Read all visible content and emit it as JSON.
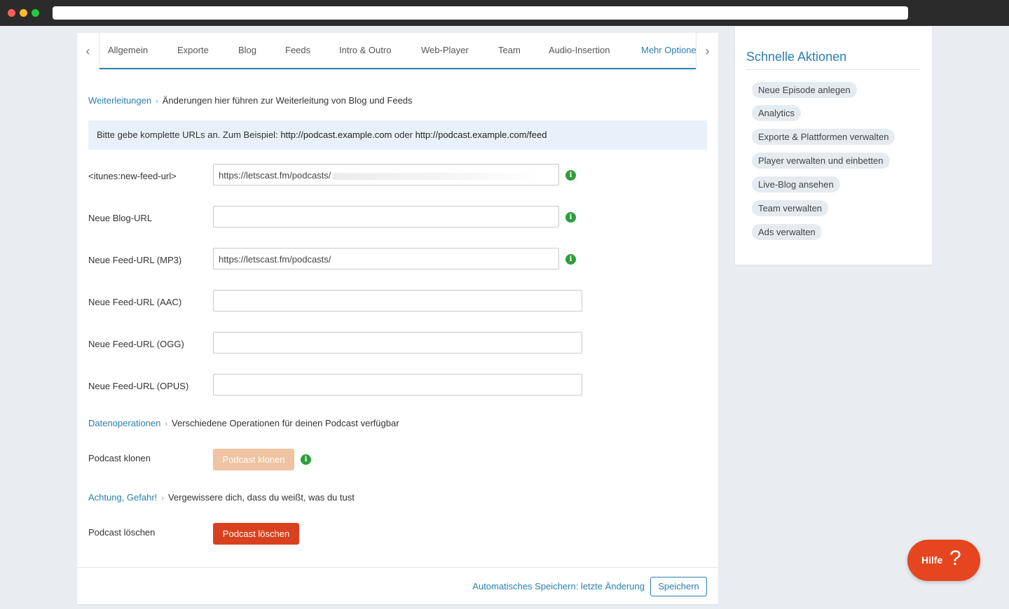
{
  "tabs": {
    "items": [
      "Allgemein",
      "Exporte",
      "Blog",
      "Feeds",
      "Intro & Outro",
      "Web-Player",
      "Team",
      "Audio-Insertion",
      "Mehr Optionen"
    ],
    "active": "Mehr Optionen"
  },
  "sections": {
    "redirects": {
      "link": "Weiterleitungen",
      "desc": "Änderungen hier führen zur Weiterleitung von Blog und Feeds"
    },
    "dataops": {
      "link": "Datenoperationen",
      "desc": "Verschiedene Operationen für deinen Podcast verfügbar"
    },
    "danger": {
      "link": "Achtung, Gefahr!",
      "desc": "Vergewissere dich, dass du weißt, was du tust"
    }
  },
  "info": {
    "prefix": "Bitte gebe komplette URLs an. Zum Beispiel:",
    "example1": "http://podcast.example.com",
    "middle": "oder",
    "example2": "http://podcast.example.com/feed"
  },
  "form": {
    "itunes": {
      "label": "<itunes:new-feed-url>",
      "value": "https://letscast.fm/podcasts/"
    },
    "blog": {
      "label": "Neue Blog-URL",
      "value": ""
    },
    "mp3": {
      "label": "Neue Feed-URL (MP3)",
      "value": "https://letscast.fm/podcasts/"
    },
    "aac": {
      "label": "Neue Feed-URL (AAC)",
      "value": ""
    },
    "ogg": {
      "label": "Neue Feed-URL (OGG)",
      "value": ""
    },
    "opus": {
      "label": "Neue Feed-URL (OPUS)",
      "value": ""
    },
    "info_icon": "i"
  },
  "clone": {
    "label": "Podcast klonen",
    "button": "Podcast klonen"
  },
  "delete": {
    "label": "Podcast löschen",
    "button": "Podcast löschen"
  },
  "footer": {
    "autosave": "Automatisches Speichern: letzte Änderung",
    "save": "Speichern"
  },
  "sidebar": {
    "title": "Schnelle Aktionen",
    "items": [
      "Neue Episode anlegen",
      "Analytics",
      "Exporte & Plattformen verwalten",
      "Player verwalten und einbetten",
      "Live-Blog ansehen",
      "Team verwalten",
      "Ads verwalten"
    ]
  },
  "help": {
    "label": "Hilfe",
    "icon": "?"
  },
  "nav": {
    "prev": "‹",
    "next": "›"
  },
  "colors": {
    "accent": "#2a7fb0",
    "danger": "#d9411e",
    "info_green": "#2e9d3a",
    "help": "#e5461f"
  }
}
